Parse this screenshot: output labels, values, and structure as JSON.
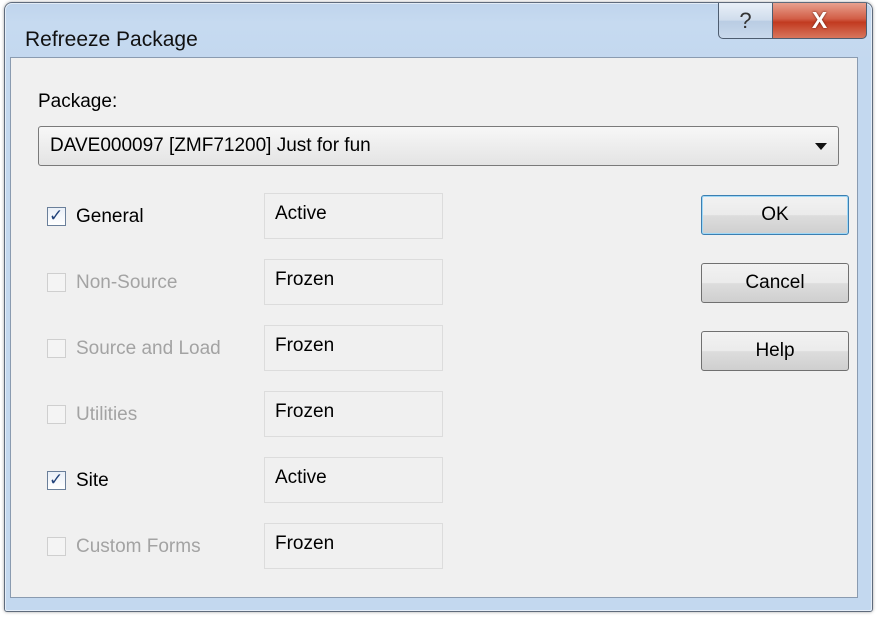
{
  "window": {
    "title": "Refreeze Package",
    "help_glyph": "?",
    "close_glyph": "X"
  },
  "package": {
    "label": "Package:",
    "selected": "DAVE000097  [ZMF71200]  Just for fun"
  },
  "components": [
    {
      "label": "General",
      "checked": true,
      "enabled": true,
      "status": "Active"
    },
    {
      "label": "Non-Source",
      "checked": false,
      "enabled": false,
      "status": "Frozen"
    },
    {
      "label": "Source and Load",
      "checked": false,
      "enabled": false,
      "status": "Frozen"
    },
    {
      "label": "Utilities",
      "checked": false,
      "enabled": false,
      "status": "Frozen"
    },
    {
      "label": "Site",
      "checked": true,
      "enabled": true,
      "status": "Active"
    },
    {
      "label": "Custom Forms",
      "checked": false,
      "enabled": false,
      "status": "Frozen"
    }
  ],
  "buttons": {
    "ok": "OK",
    "cancel": "Cancel",
    "help": "Help"
  },
  "icons": {
    "help": "question-mark-icon",
    "close": "close-icon",
    "dropdown": "dropdown-arrow-icon",
    "check": "checkmark-icon"
  }
}
